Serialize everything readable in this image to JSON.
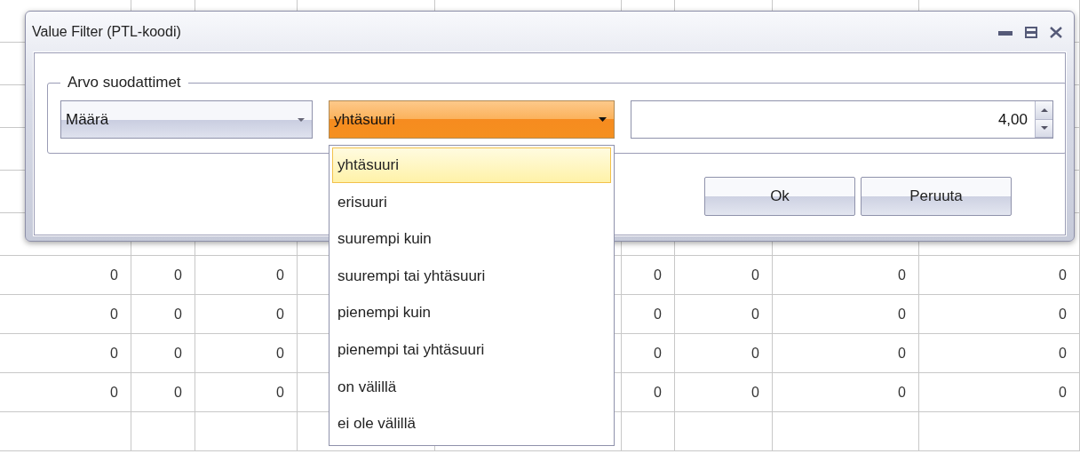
{
  "window": {
    "title": "Value Filter (PTL-koodi)"
  },
  "group": {
    "label": "Arvo suodattimet"
  },
  "field_combo": {
    "value": "Määrä"
  },
  "operator_combo": {
    "value": "yhtäsuuri",
    "expanded": true
  },
  "value_spinner": {
    "value": "4,00"
  },
  "operator_options": [
    {
      "label": "yhtäsuuri",
      "selected": true
    },
    {
      "label": "erisuuri",
      "selected": false
    },
    {
      "label": "suurempi kuin",
      "selected": false
    },
    {
      "label": "suurempi tai yhtäsuuri",
      "selected": false
    },
    {
      "label": "pienempi kuin",
      "selected": false
    },
    {
      "label": "pienempi tai yhtäsuuri",
      "selected": false
    },
    {
      "label": "on välillä",
      "selected": false
    },
    {
      "label": "ei ole välillä",
      "selected": false
    }
  ],
  "buttons": [
    "Ok",
    "Peruuta"
  ],
  "background_table": {
    "rows": [
      [
        "0",
        "0",
        "0",
        "0",
        "0",
        "0",
        "0"
      ],
      [
        "0",
        "0",
        "0",
        "0",
        "0",
        "0",
        "0"
      ],
      [
        "0",
        "0",
        "0",
        "0",
        "0",
        "0",
        "0"
      ],
      [
        "0",
        "0",
        "0",
        "0",
        "0",
        "0",
        "0"
      ]
    ]
  }
}
